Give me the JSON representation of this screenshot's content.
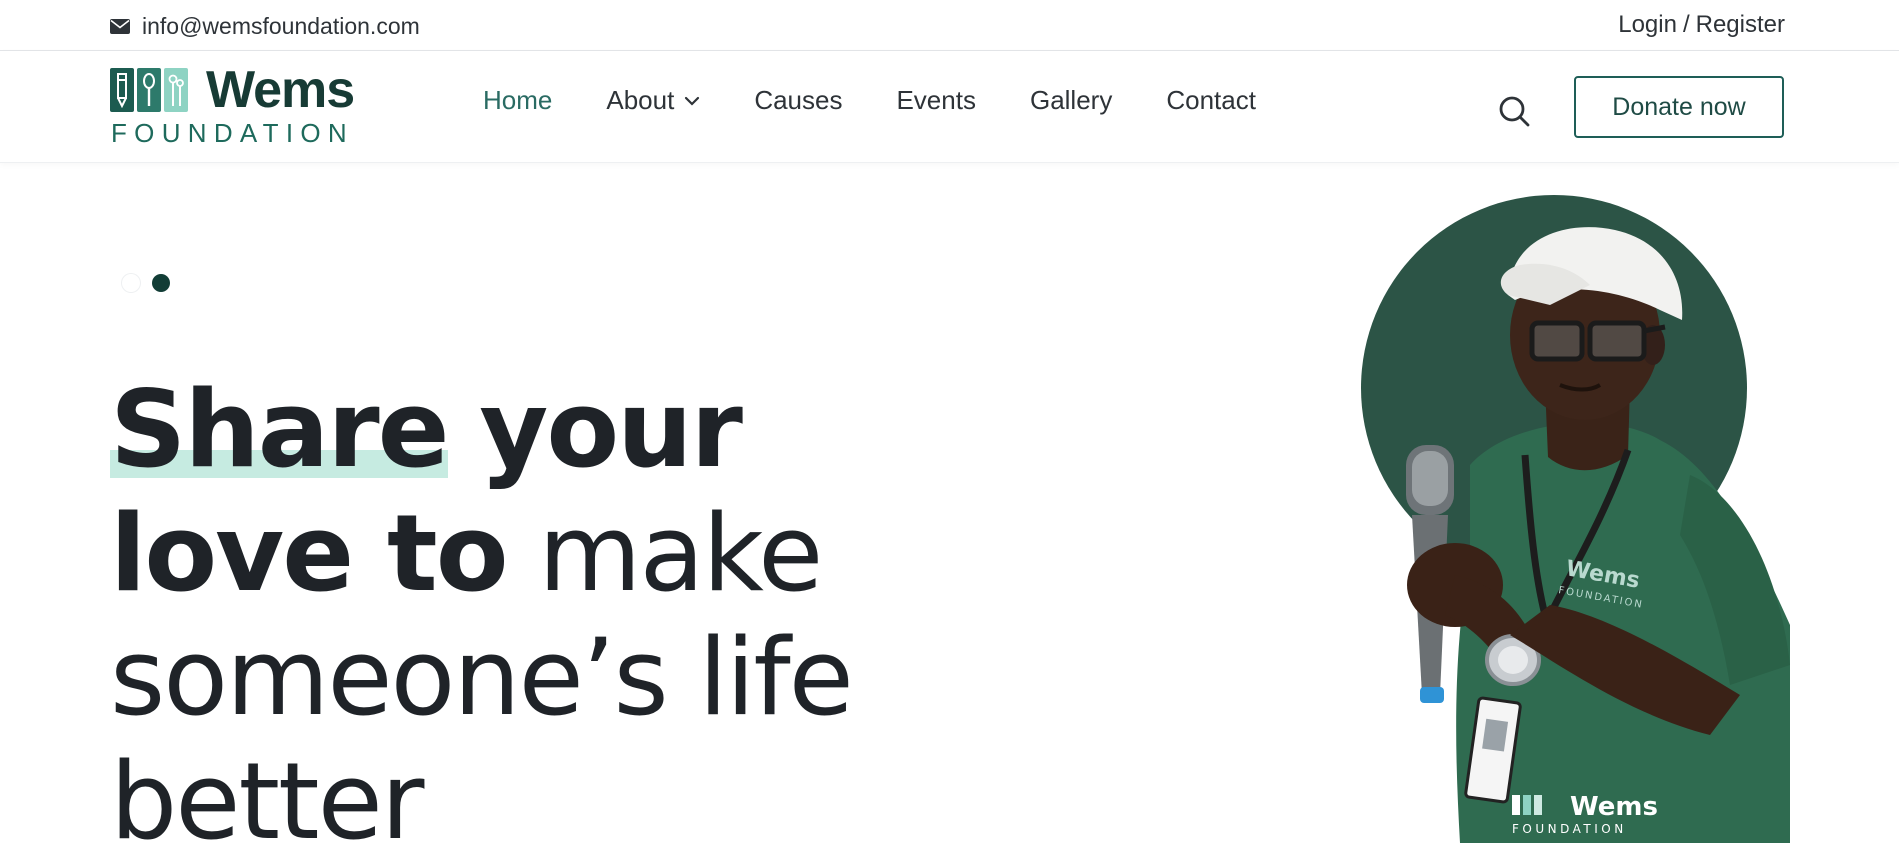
{
  "topbar": {
    "email": "info@wemsfoundation.com",
    "login": "Login",
    "separator": "/",
    "register": "Register"
  },
  "logo": {
    "wordmark": "Wems",
    "subline": "FOUNDATION"
  },
  "nav": {
    "items": [
      {
        "label": "Home",
        "active": true
      },
      {
        "label": "About",
        "has_dropdown": true
      },
      {
        "label": "Causes"
      },
      {
        "label": "Events"
      },
      {
        "label": "Gallery"
      },
      {
        "label": "Contact"
      }
    ],
    "search_icon": "search-icon",
    "donate_label": "Donate now"
  },
  "hero": {
    "slider_dots": 2,
    "active_dot": 2,
    "headline": {
      "part1_bold": "Share",
      "part2_bold": "your",
      "part3_bold": "love to",
      "part4": "make",
      "part5": "someone’s life",
      "part6": "better"
    },
    "shirt_logo": "Wems",
    "shirt_sub": "FOUNDATION"
  },
  "colors": {
    "brand_dark": "#173b35",
    "brand_green": "#2a6b63",
    "highlight": "#c6ebe1",
    "circle": "#2c5446",
    "shirt": "#2f6b50"
  }
}
